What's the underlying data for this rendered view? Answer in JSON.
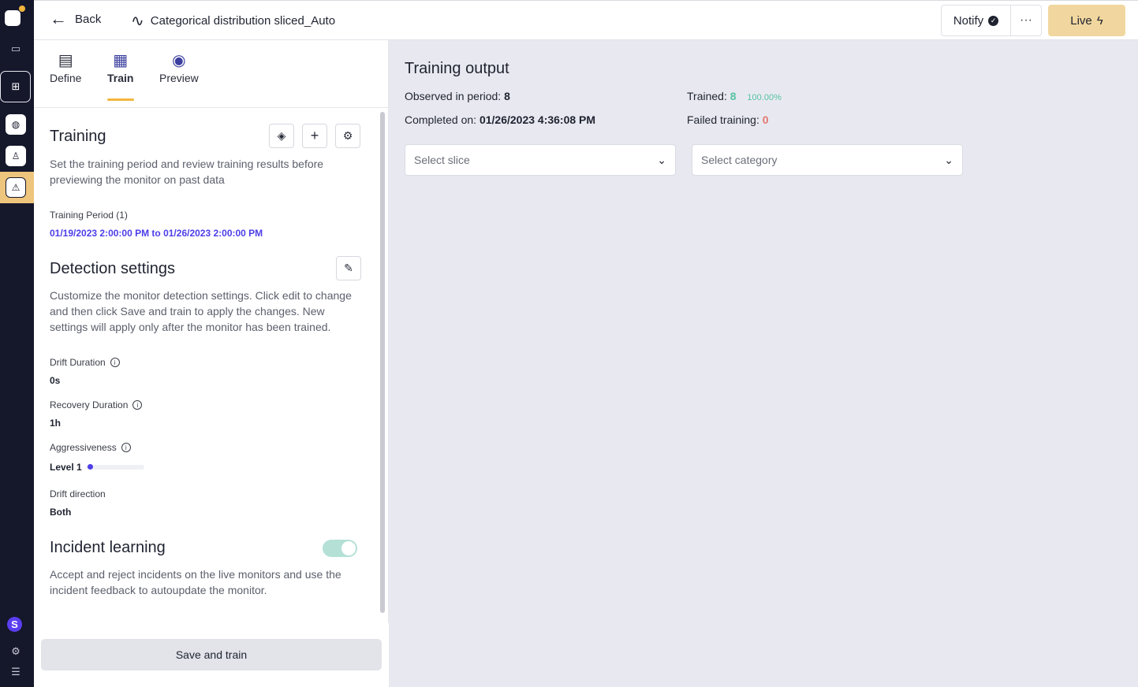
{
  "header": {
    "back_label": "Back",
    "monitor_title": "Categorical distribution sliced_Auto",
    "notify_label": "Notify",
    "more_label": "···",
    "live_label": "Live"
  },
  "rail": {
    "avatar_initial": "S"
  },
  "tabs": [
    {
      "label": "Define",
      "icon": "book-icon"
    },
    {
      "label": "Train",
      "icon": "grid-pattern-icon"
    },
    {
      "label": "Preview",
      "icon": "eye-icon"
    }
  ],
  "training": {
    "title": "Training",
    "description": "Set the training period and review training results before previewing the monitor on past data",
    "period_label": "Training Period (1)",
    "period_value": "01/19/2023 2:00:00 PM to 01/26/2023 2:00:00 PM"
  },
  "detection": {
    "title": "Detection settings",
    "description": "Customize the monitor detection settings. Click edit to change and then click Save and train to apply the changes. New settings will apply only after the monitor has been trained.",
    "drift_duration_label": "Drift Duration",
    "drift_duration_value": "0s",
    "recovery_duration_label": "Recovery Duration",
    "recovery_duration_value": "1h",
    "aggressiveness_label": "Aggressiveness",
    "aggressiveness_value": "Level 1",
    "aggressiveness_level_fraction": 0.1,
    "drift_direction_label": "Drift direction",
    "drift_direction_value": "Both"
  },
  "incident": {
    "title": "Incident learning",
    "description": "Accept and reject incidents on the live monitors and use the incident feedback to autoupdate the monitor.",
    "enabled": true
  },
  "footer": {
    "save_label": "Save and train"
  },
  "output": {
    "title": "Training output",
    "observed_label": "Observed in period:",
    "observed_value": "8",
    "trained_label": "Trained:",
    "trained_value": "8",
    "trained_pct": "100.00%",
    "completed_label": "Completed on:",
    "completed_value": "01/26/2023 4:36:08 PM",
    "failed_label": "Failed training:",
    "failed_value": "0",
    "slice_placeholder": "Select slice",
    "category_placeholder": "Select category"
  },
  "colors": {
    "accent": "#f2b63d",
    "link": "#4d3ee8",
    "success": "#57c2a2",
    "danger": "#e3776f",
    "rail": "#15172b"
  }
}
